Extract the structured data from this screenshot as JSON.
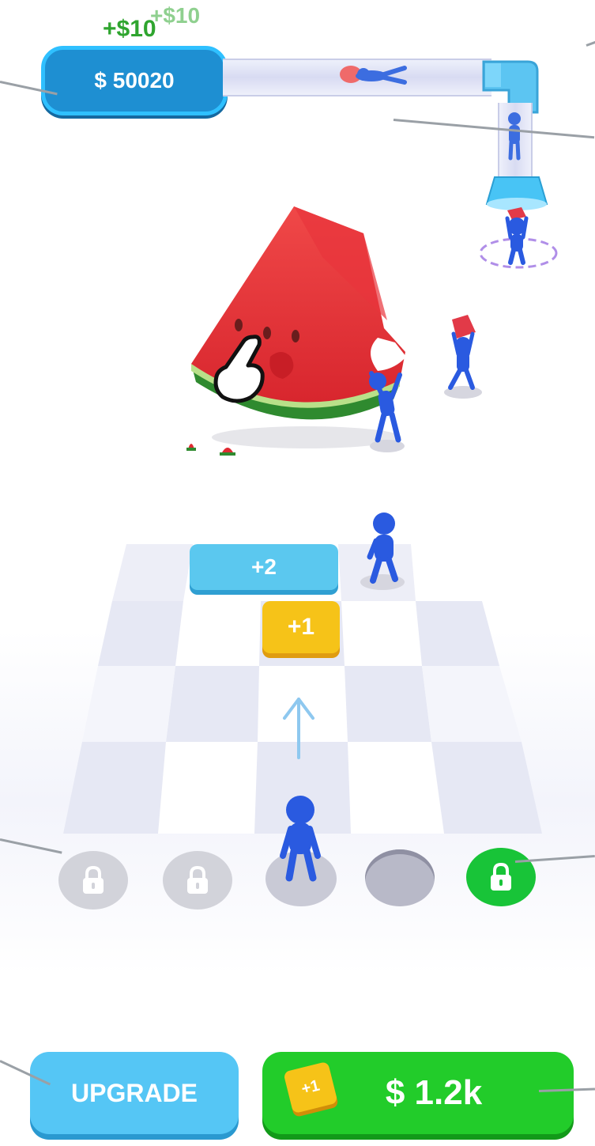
{
  "hud": {
    "float_gain_1": "+$10",
    "float_gain_2": "+$10",
    "balance": "$ 50020"
  },
  "board": {
    "merge_tile_plus2": "+2",
    "merge_tile_plus1": "+1"
  },
  "slots": [
    {
      "state": "locked"
    },
    {
      "state": "locked"
    },
    {
      "state": "occupied"
    },
    {
      "state": "empty"
    },
    {
      "state": "unlockable"
    }
  ],
  "bottom_bar": {
    "upgrade_label": "UPGRADE",
    "buy_price": "$ 1.2k",
    "buy_badge": "+1"
  },
  "colors": {
    "money_blue": "#1e8fd2",
    "money_border": "#2fc0ff",
    "tile_blue": "#5bc8ef",
    "tile_yellow": "#f6c318",
    "buy_green": "#22cc2a",
    "unlock_green": "#18c438",
    "stickman_blue": "#1f4fd8",
    "lock_grey": "#d2d3da"
  }
}
